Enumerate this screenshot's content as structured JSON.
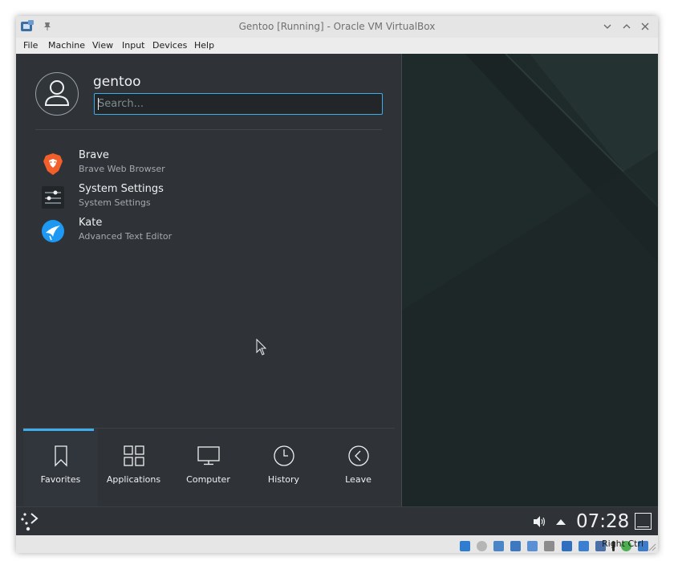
{
  "window": {
    "title": "Gentoo [Running] - Oracle VM VirtualBox",
    "app_icon": "virtualbox-icon",
    "pin_icon": "pin-icon",
    "controls": [
      "minimize-icon",
      "maximize-icon",
      "close-icon"
    ]
  },
  "menubar": {
    "items": [
      {
        "label": "File"
      },
      {
        "label": "Machine"
      },
      {
        "label": "View"
      },
      {
        "label": "Input"
      },
      {
        "label": "Devices"
      },
      {
        "label": "Help"
      }
    ]
  },
  "launcher": {
    "username": "gentoo",
    "search_placeholder": "Search...",
    "favorites": [
      {
        "name": "Brave",
        "description": "Brave Web Browser",
        "icon": "brave-icon"
      },
      {
        "name": "System Settings",
        "description": "System Settings",
        "icon": "system-settings-icon"
      },
      {
        "name": "Kate",
        "description": "Advanced Text Editor",
        "icon": "kate-icon"
      }
    ],
    "tabs": [
      {
        "label": "Favorites",
        "icon": "bookmark-icon",
        "active": true
      },
      {
        "label": "Applications",
        "icon": "grid-icon",
        "active": false
      },
      {
        "label": "Computer",
        "icon": "monitor-icon",
        "active": false
      },
      {
        "label": "History",
        "icon": "clock-icon",
        "active": false
      },
      {
        "label": "Leave",
        "icon": "back-arrow-icon",
        "active": false
      }
    ]
  },
  "panel": {
    "clock": "07:28",
    "tray_icons": [
      "volume-icon",
      "expand-arrow-icon",
      "show-desktop-icon"
    ],
    "launcher_icon": "gentoo-kicker-icon"
  },
  "statusbar": {
    "host_key": "Right Ctrl",
    "icons": [
      "hard-disk-icon",
      "optical-drive-icon",
      "audio-icon",
      "network-icon",
      "usb-icon",
      "shared-folders-icon",
      "display-icon",
      "recording-icon",
      "cpu-icon",
      "mouse-integration-icon",
      "keyboard-icon"
    ]
  },
  "colors": {
    "accent": "#3daee9",
    "launcher_bg": "#2f3338",
    "desktop_bg": "#1f2828"
  }
}
